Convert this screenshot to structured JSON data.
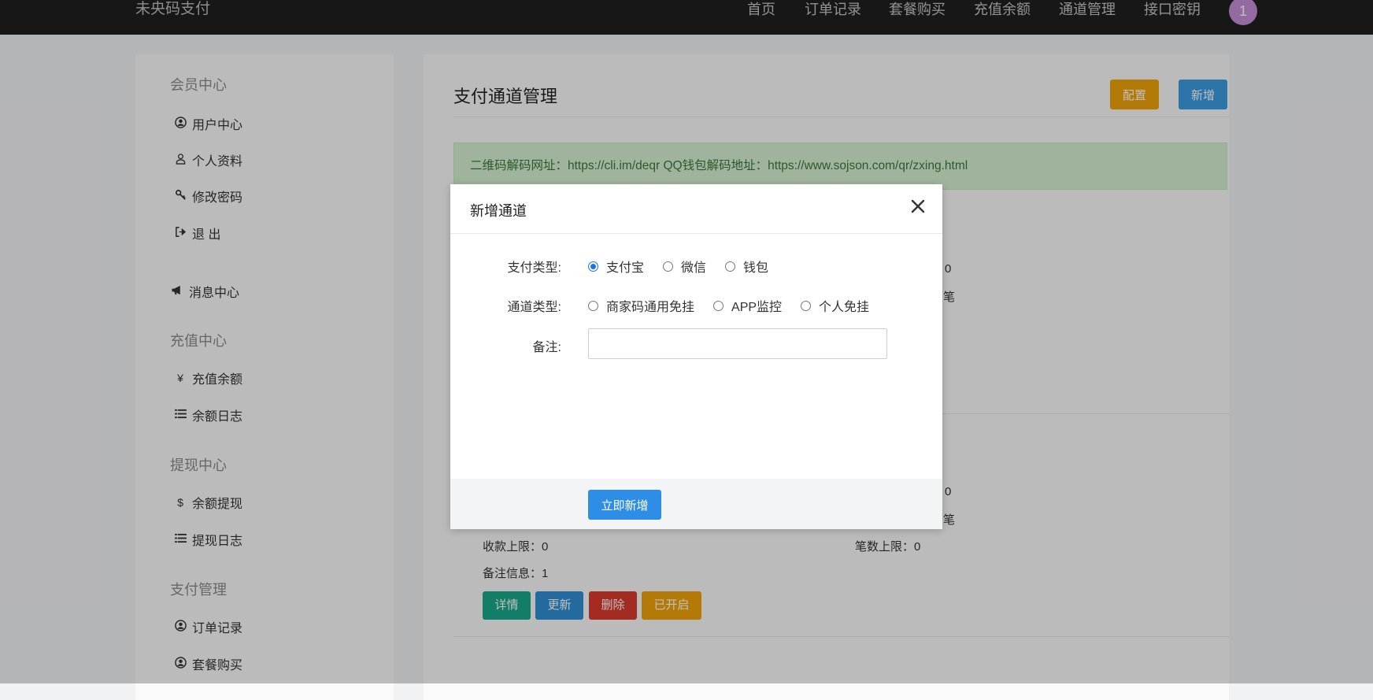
{
  "navbar": {
    "brand": "未央码支付",
    "links": [
      "首页",
      "订单记录",
      "套餐购买",
      "充值余额",
      "通道管理",
      "接口密钥"
    ],
    "badge": "1"
  },
  "sidebar": {
    "sections": [
      {
        "title": "会员中心",
        "items": [
          {
            "label": "用户中心",
            "icon": "user-circle-icon"
          },
          {
            "label": "个人资料",
            "icon": "user-icon"
          },
          {
            "label": "修改密码",
            "icon": "key-icon"
          },
          {
            "label": "退 出",
            "icon": "sign-out-icon"
          }
        ]
      },
      {
        "title": "",
        "items": [
          {
            "label": "消息中心",
            "icon": "bullhorn-icon"
          }
        ]
      },
      {
        "title": "充值中心",
        "items": [
          {
            "label": "充值余额",
            "icon": "yen-icon"
          },
          {
            "label": "余额日志",
            "icon": "list-icon"
          }
        ]
      },
      {
        "title": "提现中心",
        "items": [
          {
            "label": "余额提现",
            "icon": "dollar-icon"
          },
          {
            "label": "提现日志",
            "icon": "list-icon"
          }
        ]
      },
      {
        "title": "支付管理",
        "items": [
          {
            "label": "订单记录",
            "icon": "user-circle-icon"
          },
          {
            "label": "套餐购买",
            "icon": "user-circle-icon"
          }
        ]
      }
    ]
  },
  "main": {
    "title": "支付通道管理",
    "config_label": "配置",
    "add_label": "新增",
    "alert": "二维码解码网址：https://cli.im/deqr   QQ钱包解码地址：https://www.sojson.com/qr/zxing.html",
    "peek": {
      "card1_a": "0",
      "card1_b": "笔",
      "card2_a": "0",
      "card2_b": "笔"
    },
    "card": {
      "limit_label": "收款上限：0",
      "count_limit_label": "笔数上限：0",
      "note_label": "备注信息：1",
      "actions": [
        {
          "label": "详情",
          "color": "#1aa88b"
        },
        {
          "label": "更新",
          "color": "#2f8fd4"
        },
        {
          "label": "删除",
          "color": "#d93a2e"
        },
        {
          "label": "已开启",
          "color": "#f0a30a"
        }
      ]
    }
  },
  "modal": {
    "title": "新增通道",
    "pay_type_label": "支付类型:",
    "pay_type_options": [
      "支付宝",
      "微信",
      "钱包"
    ],
    "pay_type_selected": "支付宝",
    "channel_type_label": "通道类型:",
    "channel_type_options": [
      "商家码通用免挂",
      "APP监控",
      "个人免挂"
    ],
    "remark_label": "备注:",
    "remark_value": "",
    "submit_label": "立即新增"
  }
}
